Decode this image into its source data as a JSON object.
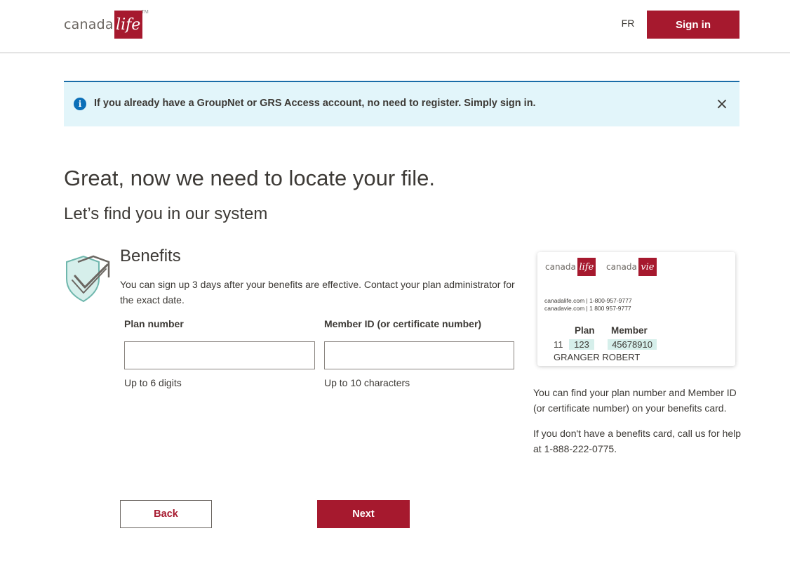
{
  "header": {
    "logo_text": "canada",
    "logo_mark": "life",
    "logo_tm": "TM",
    "lang_link": "FR",
    "signin_label": "Sign in",
    "brand_color": "#a6192e"
  },
  "banner": {
    "icon": "info-icon",
    "text": "If you already have a GroupNet or GRS Access account, no need to register. Simply sign in.",
    "close_icon": "close-icon",
    "close_glyph": "×"
  },
  "page": {
    "title": "Great, now we need to locate your file.",
    "subtitle": "Let’s find you in our system"
  },
  "benefits": {
    "icon": "shield-check-icon",
    "title": "Benefits",
    "description": "You can sign up 3 days after your benefits are effective. Contact your plan administrator for the exact date.",
    "plan_field": {
      "label": "Plan number",
      "value": "",
      "placeholder": "",
      "hint": "Up to 6 digits"
    },
    "member_field": {
      "label": "Member ID (or certificate number)",
      "value": "",
      "placeholder": "",
      "hint": "Up to 10 characters"
    }
  },
  "card": {
    "logo1_word": "canada",
    "logo1_mark": "life",
    "logo2_word": "canada",
    "logo2_mark": "vie",
    "web_line1": "canadalife.com | 1-800-957-9777",
    "web_line2": "canadavie.com | 1 800 957-9777",
    "plan_header": "Plan",
    "member_header": "Member",
    "prefix": "11",
    "plan_value": "123",
    "member_value": "45678910",
    "name": "GRANGER ROBERT",
    "highlight_color": "#d6efeb"
  },
  "side": {
    "text1": "You can find your plan number and Member ID (or certificate number) on your benefits card.",
    "text2": "If you don't have a benefits card, call us for help at 1-888-222-0775."
  },
  "actions": {
    "back_label": "Back",
    "next_label": "Next"
  }
}
